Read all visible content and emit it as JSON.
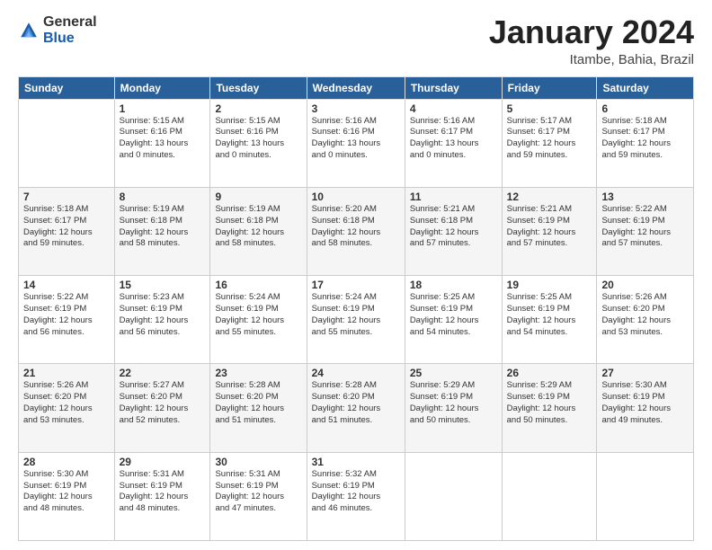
{
  "logo": {
    "general": "General",
    "blue": "Blue"
  },
  "title": {
    "month": "January 2024",
    "location": "Itambe, Bahia, Brazil"
  },
  "headers": [
    "Sunday",
    "Monday",
    "Tuesday",
    "Wednesday",
    "Thursday",
    "Friday",
    "Saturday"
  ],
  "weeks": [
    [
      {
        "day": "",
        "info": ""
      },
      {
        "day": "1",
        "info": "Sunrise: 5:15 AM\nSunset: 6:16 PM\nDaylight: 13 hours\nand 0 minutes."
      },
      {
        "day": "2",
        "info": "Sunrise: 5:15 AM\nSunset: 6:16 PM\nDaylight: 13 hours\nand 0 minutes."
      },
      {
        "day": "3",
        "info": "Sunrise: 5:16 AM\nSunset: 6:16 PM\nDaylight: 13 hours\nand 0 minutes."
      },
      {
        "day": "4",
        "info": "Sunrise: 5:16 AM\nSunset: 6:17 PM\nDaylight: 13 hours\nand 0 minutes."
      },
      {
        "day": "5",
        "info": "Sunrise: 5:17 AM\nSunset: 6:17 PM\nDaylight: 12 hours\nand 59 minutes."
      },
      {
        "day": "6",
        "info": "Sunrise: 5:18 AM\nSunset: 6:17 PM\nDaylight: 12 hours\nand 59 minutes."
      }
    ],
    [
      {
        "day": "7",
        "info": "Sunrise: 5:18 AM\nSunset: 6:17 PM\nDaylight: 12 hours\nand 59 minutes."
      },
      {
        "day": "8",
        "info": "Sunrise: 5:19 AM\nSunset: 6:18 PM\nDaylight: 12 hours\nand 58 minutes."
      },
      {
        "day": "9",
        "info": "Sunrise: 5:19 AM\nSunset: 6:18 PM\nDaylight: 12 hours\nand 58 minutes."
      },
      {
        "day": "10",
        "info": "Sunrise: 5:20 AM\nSunset: 6:18 PM\nDaylight: 12 hours\nand 58 minutes."
      },
      {
        "day": "11",
        "info": "Sunrise: 5:21 AM\nSunset: 6:18 PM\nDaylight: 12 hours\nand 57 minutes."
      },
      {
        "day": "12",
        "info": "Sunrise: 5:21 AM\nSunset: 6:19 PM\nDaylight: 12 hours\nand 57 minutes."
      },
      {
        "day": "13",
        "info": "Sunrise: 5:22 AM\nSunset: 6:19 PM\nDaylight: 12 hours\nand 57 minutes."
      }
    ],
    [
      {
        "day": "14",
        "info": "Sunrise: 5:22 AM\nSunset: 6:19 PM\nDaylight: 12 hours\nand 56 minutes."
      },
      {
        "day": "15",
        "info": "Sunrise: 5:23 AM\nSunset: 6:19 PM\nDaylight: 12 hours\nand 56 minutes."
      },
      {
        "day": "16",
        "info": "Sunrise: 5:24 AM\nSunset: 6:19 PM\nDaylight: 12 hours\nand 55 minutes."
      },
      {
        "day": "17",
        "info": "Sunrise: 5:24 AM\nSunset: 6:19 PM\nDaylight: 12 hours\nand 55 minutes."
      },
      {
        "day": "18",
        "info": "Sunrise: 5:25 AM\nSunset: 6:19 PM\nDaylight: 12 hours\nand 54 minutes."
      },
      {
        "day": "19",
        "info": "Sunrise: 5:25 AM\nSunset: 6:19 PM\nDaylight: 12 hours\nand 54 minutes."
      },
      {
        "day": "20",
        "info": "Sunrise: 5:26 AM\nSunset: 6:20 PM\nDaylight: 12 hours\nand 53 minutes."
      }
    ],
    [
      {
        "day": "21",
        "info": "Sunrise: 5:26 AM\nSunset: 6:20 PM\nDaylight: 12 hours\nand 53 minutes."
      },
      {
        "day": "22",
        "info": "Sunrise: 5:27 AM\nSunset: 6:20 PM\nDaylight: 12 hours\nand 52 minutes."
      },
      {
        "day": "23",
        "info": "Sunrise: 5:28 AM\nSunset: 6:20 PM\nDaylight: 12 hours\nand 51 minutes."
      },
      {
        "day": "24",
        "info": "Sunrise: 5:28 AM\nSunset: 6:20 PM\nDaylight: 12 hours\nand 51 minutes."
      },
      {
        "day": "25",
        "info": "Sunrise: 5:29 AM\nSunset: 6:19 PM\nDaylight: 12 hours\nand 50 minutes."
      },
      {
        "day": "26",
        "info": "Sunrise: 5:29 AM\nSunset: 6:19 PM\nDaylight: 12 hours\nand 50 minutes."
      },
      {
        "day": "27",
        "info": "Sunrise: 5:30 AM\nSunset: 6:19 PM\nDaylight: 12 hours\nand 49 minutes."
      }
    ],
    [
      {
        "day": "28",
        "info": "Sunrise: 5:30 AM\nSunset: 6:19 PM\nDaylight: 12 hours\nand 48 minutes."
      },
      {
        "day": "29",
        "info": "Sunrise: 5:31 AM\nSunset: 6:19 PM\nDaylight: 12 hours\nand 48 minutes."
      },
      {
        "day": "30",
        "info": "Sunrise: 5:31 AM\nSunset: 6:19 PM\nDaylight: 12 hours\nand 47 minutes."
      },
      {
        "day": "31",
        "info": "Sunrise: 5:32 AM\nSunset: 6:19 PM\nDaylight: 12 hours\nand 46 minutes."
      },
      {
        "day": "",
        "info": ""
      },
      {
        "day": "",
        "info": ""
      },
      {
        "day": "",
        "info": ""
      }
    ]
  ]
}
